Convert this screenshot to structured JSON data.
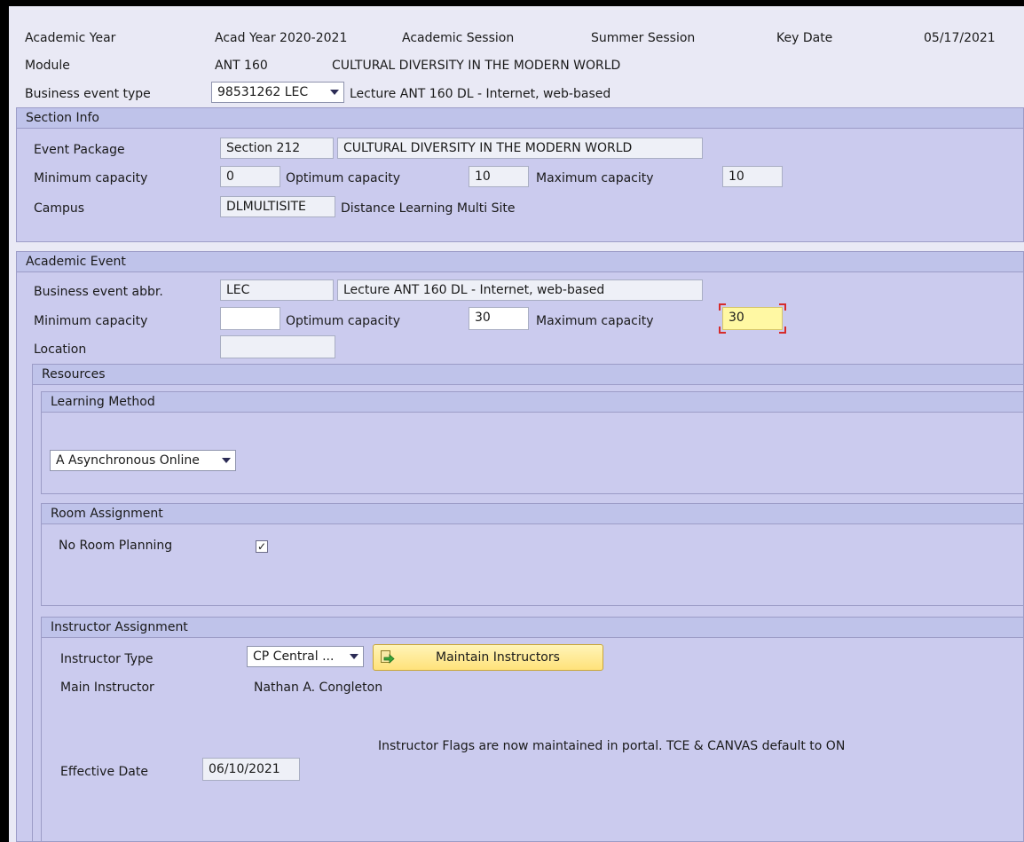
{
  "header": {
    "academic_year_label": "Academic Year",
    "academic_year_value": "Acad Year 2020-2021",
    "academic_session_label": "Academic Session",
    "academic_session_value": "Summer Session",
    "key_date_label": "Key Date",
    "key_date_value": "05/17/2021",
    "module_label": "Module",
    "module_code": "ANT 160",
    "module_title": "CULTURAL DIVERSITY IN THE MODERN WORLD",
    "business_event_type_label": "Business event type",
    "business_event_type_value": "98531262 LEC",
    "business_event_type_desc": "Lecture ANT 160 DL - Internet, web-based"
  },
  "section_info": {
    "title": "Section Info",
    "event_package_label": "Event Package",
    "event_package_code": "Section 212",
    "event_package_desc": "CULTURAL DIVERSITY IN THE MODERN WORLD",
    "min_capacity_label": "Minimum capacity",
    "min_capacity_value": "0",
    "opt_capacity_label": "Optimum capacity",
    "opt_capacity_value": "10",
    "max_capacity_label": "Maximum capacity",
    "max_capacity_value": "10",
    "campus_label": "Campus",
    "campus_code": "DLMULTISITE",
    "campus_desc": "Distance Learning Multi Site"
  },
  "academic_event": {
    "title": "Academic Event",
    "abbr_label": "Business event abbr.",
    "abbr_value": "LEC",
    "abbr_desc": "Lecture ANT 160 DL - Internet, web-based",
    "min_capacity_label": "Minimum capacity",
    "min_capacity_value": "",
    "opt_capacity_label": "Optimum capacity",
    "opt_capacity_value": "30",
    "max_capacity_label": "Maximum capacity",
    "max_capacity_value": "30",
    "location_label": "Location",
    "location_value": ""
  },
  "resources": {
    "title": "Resources",
    "learning_method": {
      "title": "Learning Method",
      "selected": "A Asynchronous Online"
    },
    "room_assignment": {
      "title": "Room Assignment",
      "no_room_planning_label": "No Room Planning",
      "no_room_planning_checked": "✓"
    },
    "instructor_assignment": {
      "title": "Instructor Assignment",
      "instructor_type_label": "Instructor Type",
      "instructor_type_value": "CP Central ...",
      "maintain_button_label": "Maintain Instructors",
      "main_instructor_label": "Main Instructor",
      "main_instructor_value": "Nathan A. Congleton",
      "flags_note": "Instructor Flags are now maintained in portal. TCE & CANVAS default to ON",
      "effective_date_label": "Effective Date",
      "effective_date_value": "06/10/2021"
    }
  },
  "colors": {
    "group_bg": "#cbcbee",
    "group_header_bg": "#bfc3ea",
    "focus_field": "#fff8a3",
    "button_yellow": "#ffe27a",
    "focus_marker": "#d62b2b"
  }
}
